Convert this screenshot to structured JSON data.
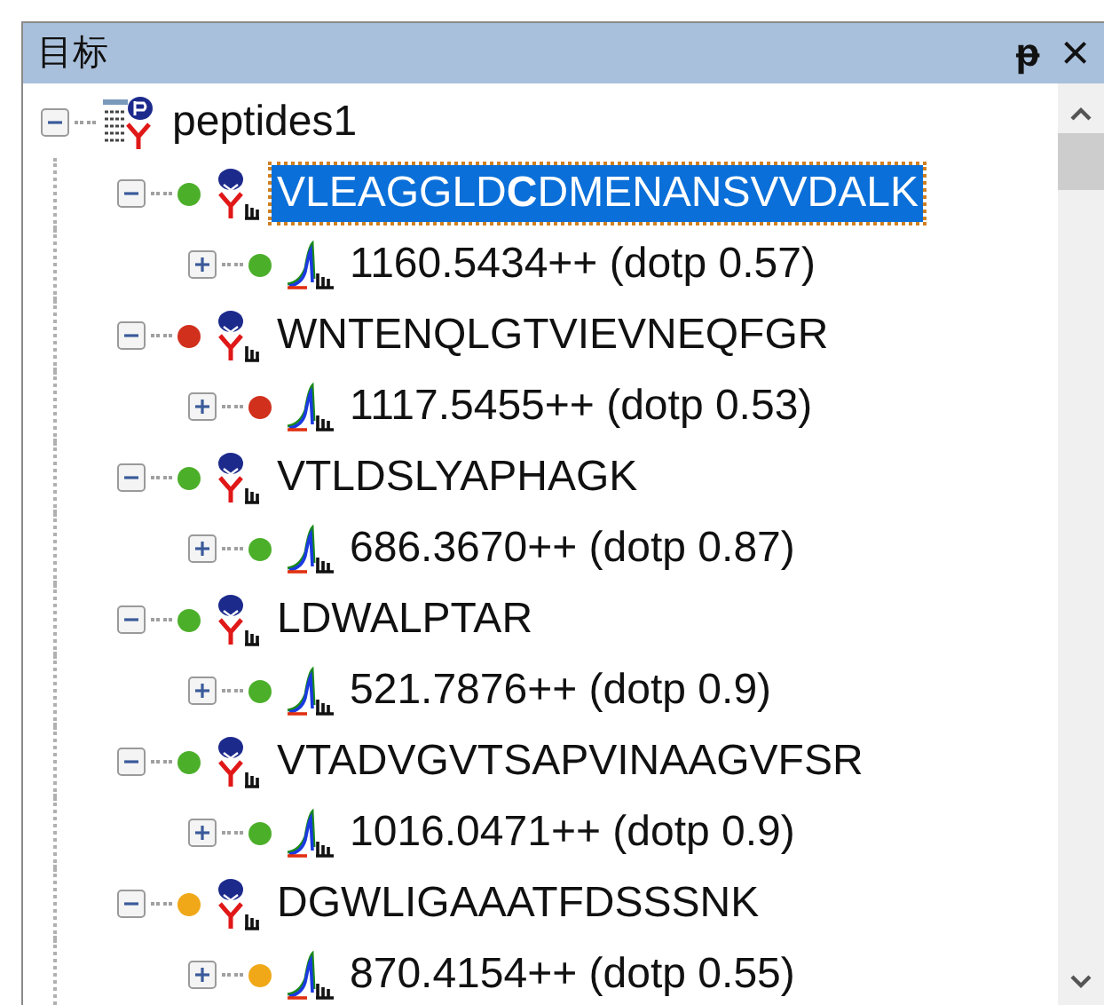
{
  "panel": {
    "title": "目标",
    "pin": "ᵽ",
    "close": "×"
  },
  "tree": {
    "label": "peptides1",
    "expanded": true,
    "children": [
      {
        "label": "VLEAGGLD**C**DMENANSVVDALK",
        "selected": true,
        "expanded": true,
        "color": "#4caf2a",
        "children": [
          {
            "label": "1160.5434++ (dotp 0.57)",
            "expanded": false,
            "color": "#4caf2a"
          }
        ]
      },
      {
        "label": "WNTENQLGTVIEVNEQFGR",
        "selected": false,
        "expanded": true,
        "color": "#d0301c",
        "children": [
          {
            "label": "1117.5455++ (dotp 0.53)",
            "expanded": false,
            "color": "#d0301c"
          }
        ]
      },
      {
        "label": "VTLDSLYAPHAGK",
        "selected": false,
        "expanded": true,
        "color": "#4caf2a",
        "children": [
          {
            "label": "686.3670++ (dotp 0.87)",
            "expanded": false,
            "color": "#4caf2a"
          }
        ]
      },
      {
        "label": "LDWALPTAR",
        "selected": false,
        "expanded": true,
        "color": "#4caf2a",
        "children": [
          {
            "label": "521.7876++ (dotp 0.9)",
            "expanded": false,
            "color": "#4caf2a"
          }
        ]
      },
      {
        "label": "VTADVGVTSAPVINAAGVFSR",
        "selected": false,
        "expanded": true,
        "color": "#4caf2a",
        "children": [
          {
            "label": "1016.0471++ (dotp 0.9)",
            "expanded": false,
            "color": "#4caf2a"
          }
        ]
      },
      {
        "label": "DGWLIGAAATFDSSSNK",
        "selected": false,
        "expanded": true,
        "color": "#f0a818",
        "children": [
          {
            "label": "870.4154++ (dotp 0.55)",
            "expanded": false,
            "color": "#f0a818"
          }
        ]
      }
    ]
  }
}
